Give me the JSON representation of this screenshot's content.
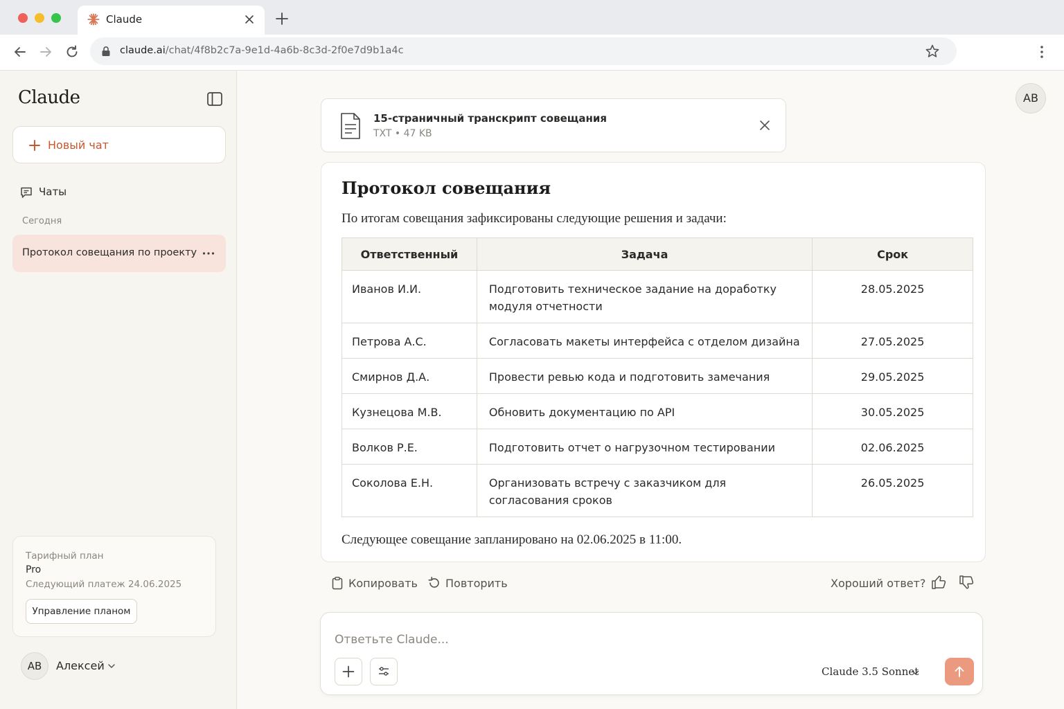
{
  "browser": {
    "tab_title": "Claude",
    "url_host": "claude.ai",
    "url_path": "/chat/4f8b2c7a-9e1d-4a6b-8c3d-2f0e7d9b1a4c"
  },
  "sidebar": {
    "brand": "Claude",
    "new_chat_label": "Новый чат",
    "chats_label": "Чаты",
    "section_today": "Сегодня",
    "chat_items": [
      {
        "label": "Протокол совещания по проекту",
        "active": true
      }
    ],
    "plan": {
      "caption": "Тарифный план",
      "name": "Pro",
      "next_payment": "Следующий платеж 24.06.2025",
      "manage_label": "Управление планом"
    },
    "user": {
      "initials": "АВ",
      "name": "Алексей"
    }
  },
  "header": {
    "avatar_initials": "АВ"
  },
  "attachment": {
    "title": "15-страничный транскрипт совещания",
    "meta": "TXT • 47 KB"
  },
  "response": {
    "title": "Протокол совещания",
    "intro": "По итогам совещания зафиксированы следующие решения и задачи:",
    "table": {
      "headers": [
        "Ответственный",
        "Задача",
        "Срок"
      ],
      "rows": [
        [
          "Иванов И.И.",
          "Подготовить техническое задание на доработку модуля отчетности",
          "28.05.2025"
        ],
        [
          "Петрова А.С.",
          "Согласовать макеты интерфейса с отделом дизайна",
          "27.05.2025"
        ],
        [
          "Смирнов Д.А.",
          "Провести ревью кода и подготовить замечания",
          "29.05.2025"
        ],
        [
          "Кузнецова М.В.",
          "Обновить документацию по API",
          "30.05.2025"
        ],
        [
          "Волков Р.Е.",
          "Подготовить отчет о нагрузочном тестировании",
          "02.06.2025"
        ],
        [
          "Соколова Е.Н.",
          "Организовать встречу с заказчиком для согласования сроков",
          "26.05.2025"
        ]
      ]
    },
    "footer": "Следующее совещание запланировано на 02.06.2025 в 11:00."
  },
  "actions": {
    "copy_label": "Копировать",
    "retry_label": "Повторить",
    "feedback_question": "Хороший ответ?"
  },
  "composer": {
    "placeholder": "Ответьте Claude...",
    "model": "Claude 3.5 Sonnet"
  },
  "colors": {
    "accent": "#c4572e",
    "active_chat_bg": "#f8e4dc",
    "send_button": "#eb9a80",
    "sidebar_bg": "#f7f5f0",
    "main_bg": "#faf9f5"
  },
  "icons": [
    "claude-logo-icon",
    "close-icon",
    "plus-icon",
    "back-icon",
    "forward-icon",
    "reload-icon",
    "lock-icon",
    "star-icon",
    "kebab-menu-icon",
    "sidebar-toggle-icon",
    "chat-bubble-icon",
    "more-icon",
    "chevron-down-icon",
    "file-icon",
    "clipboard-icon",
    "retry-icon",
    "thumbs-up-icon",
    "thumbs-down-icon",
    "sliders-icon",
    "arrow-up-icon"
  ]
}
